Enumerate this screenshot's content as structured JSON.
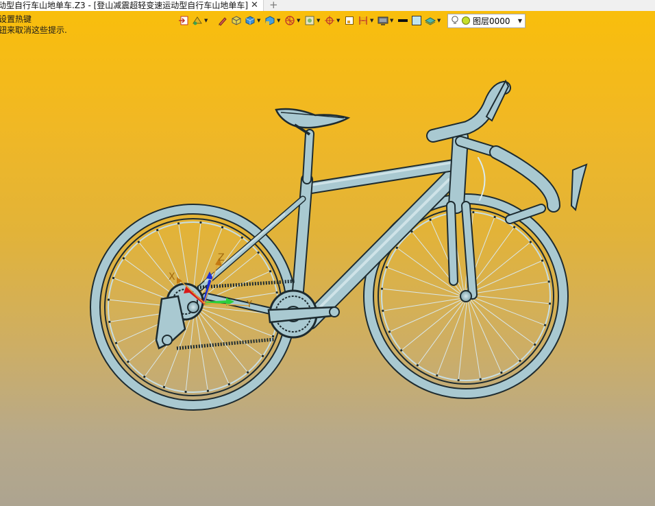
{
  "tab": {
    "title": "动型自行车山地单车.Z3 - [登山减震超轻变速运动型自行车山地单车]",
    "close_glyph": "✕",
    "add_glyph": "+"
  },
  "hints": {
    "line1": "设置热键",
    "line2": "钮来取消这些提示."
  },
  "toolbar": {
    "icons": [
      "export-icon",
      "color-palette-icon",
      "pen-icon",
      "shaded-cube-icon",
      "solid-cube-icon",
      "view-cube-icon",
      "section-wheel-icon",
      "frame-view-icon",
      "target-icon",
      "box-icon",
      "dimension-icon",
      "display-icon",
      "line-style-icon",
      "color-swatch-icon",
      "layers-icon"
    ],
    "layer_dropdown": {
      "value": "图层0000",
      "bulb_icon": "lightbulb-icon",
      "dot_icon": "layer-color-dot-icon"
    }
  },
  "axis_labels": {
    "x": "X",
    "y": "Y",
    "z": "Z"
  },
  "colors": {
    "viewport_top": "#f9be0c",
    "viewport_bottom": "#ada490",
    "model": "#a9c9d1",
    "model_edge": "#1d2b30"
  }
}
